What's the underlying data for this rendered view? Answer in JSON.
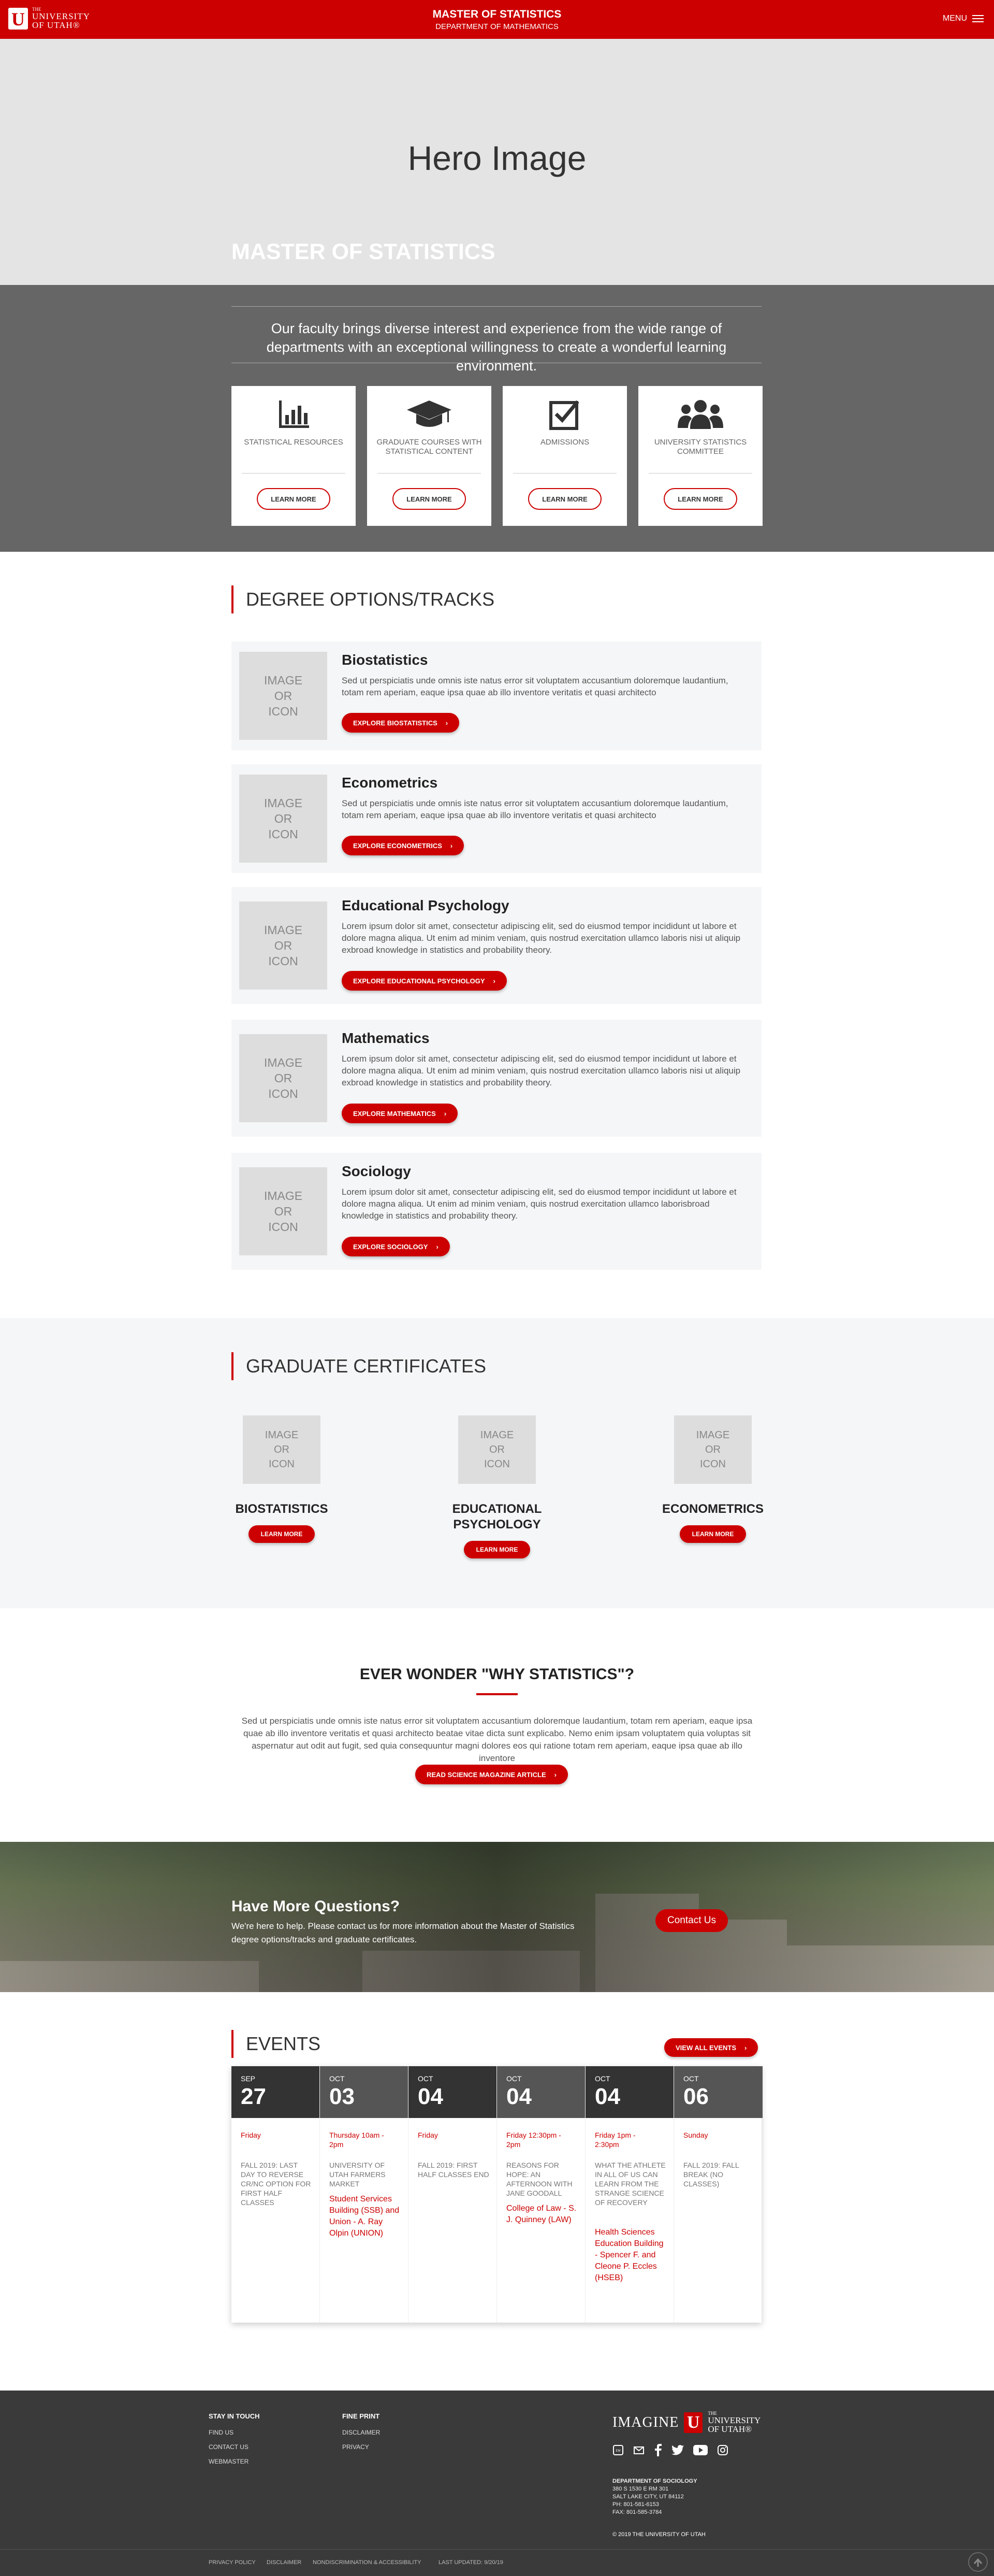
{
  "header": {
    "the": "THE",
    "university": "UNIVERSITY",
    "of_utah": "OF UTAH®",
    "title": "MASTER OF STATISTICS",
    "subtitle": "DEPARTMENT OF MATHEMATICS",
    "menu_label": "MENU"
  },
  "hero": {
    "placeholder": "Hero Image",
    "heading": "MASTER OF STATISTICS"
  },
  "intro": {
    "text": "Our faculty brings diverse interest and experience from the wide range of departments with an exceptional willingness to create a wonderful learning environment.",
    "cards": [
      {
        "label": "STATISTICAL RESOURCES",
        "icon": "bar-chart-icon",
        "button": "LEARN MORE"
      },
      {
        "label": "GRADUATE COURSES WITH STATISTICAL CONTENT",
        "icon": "graduation-cap-icon",
        "button": "LEARN MORE"
      },
      {
        "label": "ADMISSIONS",
        "icon": "checkbox-icon",
        "button": "LEARN MORE"
      },
      {
        "label": "UNIVERSITY STATISTICS COMMITTEE",
        "icon": "users-icon",
        "button": "LEARN MORE"
      }
    ]
  },
  "degrees": {
    "heading": "DEGREE OPTIONS/TRACKS",
    "image_placeholder": "IMAGE OR ICON",
    "items": [
      {
        "title": "Biostatistics",
        "text": "Sed ut perspiciatis unde omnis iste natus error sit voluptatem accusantium doloremque laudantium, totam rem aperiam, eaque ipsa quae ab illo inventore veritatis et quasi architecto",
        "button": "EXPLORE BIOSTATISTICS"
      },
      {
        "title": "Econometrics",
        "text": "Sed ut perspiciatis unde omnis iste natus error sit voluptatem accusantium doloremque laudantium, totam rem aperiam, eaque ipsa quae ab illo inventore veritatis et quasi architecto",
        "button": "EXPLORE ECONOMETRICS"
      },
      {
        "title": "Educational Psychology",
        "text": "Lorem ipsum dolor sit amet, consectetur adipiscing elit, sed do eiusmod tempor incididunt ut labore et dolore magna aliqua. Ut enim ad minim veniam, quis nostrud exercitation ullamco laboris nisi ut aliquip exbroad knowledge in statistics and probability theory.",
        "button": "EXPLORE EDUCATIONAL PSYCHOLOGY"
      },
      {
        "title": "Mathematics",
        "text": "Lorem ipsum dolor sit amet, consectetur adipiscing elit, sed do eiusmod tempor incididunt ut labore et dolore magna aliqua. Ut enim ad minim veniam, quis nostrud exercitation ullamco laboris nisi ut aliquip exbroad knowledge in statistics and probability theory.",
        "button": "EXPLORE MATHEMATICS"
      },
      {
        "title": "Sociology",
        "text": "Lorem ipsum dolor sit amet, consectetur adipiscing elit, sed do eiusmod tempor incididunt ut labore et dolore magna aliqua. Ut enim ad minim veniam, quis nostrud exercitation ullamco laborisbroad knowledge in statistics and probability theory.",
        "button": "EXPLORE SOCIOLOGY"
      }
    ]
  },
  "certificates": {
    "heading": "GRADUATE CERTIFICATES",
    "image_placeholder": "IMAGE OR ICON",
    "items": [
      {
        "title": "BIOSTATISTICS",
        "button": "LEARN MORE"
      },
      {
        "title": "EDUCATIONAL PSYCHOLOGY",
        "button": "LEARN MORE"
      },
      {
        "title": "ECONOMETRICS",
        "button": "LEARN MORE"
      }
    ]
  },
  "why": {
    "heading": "EVER WONDER \"WHY STATISTICS\"?",
    "text": "Sed ut perspiciatis unde omnis iste natus error sit voluptatem accusantium doloremque laudantium, totam rem aperiam, eaque ipsa quae ab illo inventore veritatis et quasi architecto beatae vitae dicta sunt explicabo. Nemo enim ipsam voluptatem quia voluptas sit aspernatur aut odit aut fugit, sed quia consequuntur magni dolores eos qui ratione totam rem aperiam, eaque ipsa quae ab illo inventore",
    "button": "READ SCIENCE MAGAZINE ARTICLE"
  },
  "cta": {
    "heading": "Have More Questions?",
    "text": "We're here to help. Please contact us for more information about the Master of Statistics degree options/tracks and graduate certificates.",
    "button": "Contact Us"
  },
  "events": {
    "heading": "EVENTS",
    "view_all": "VIEW ALL EVENTS",
    "items": [
      {
        "month": "SEP",
        "day": "27",
        "when": "Friday",
        "desc": "FALL 2019: LAST DAY TO REVERSE CR/NC OPTION FOR FIRST HALF CLASSES",
        "location": "",
        "color": "#333333"
      },
      {
        "month": "OCT",
        "day": "03",
        "when": "Thursday 10am - 2pm",
        "desc": "UNIVERSITY OF UTAH FARMERS MARKET",
        "location": "Student Services Building (SSB) and Union - A. Ray Olpin (UNION)",
        "color": "#555555"
      },
      {
        "month": "OCT",
        "day": "04",
        "when": "Friday",
        "desc": "FALL 2019: FIRST HALF CLASSES END",
        "location": "",
        "color": "#333333"
      },
      {
        "month": "OCT",
        "day": "04",
        "when": "Friday 12:30pm - 2pm",
        "desc": "REASONS FOR HOPE: AN AFTERNOON WITH JANE GOODALL",
        "location": "College of Law - S. J. Quinney (LAW)",
        "color": "#555555"
      },
      {
        "month": "OCT",
        "day": "04",
        "when": "Friday 1pm - 2:30pm",
        "desc": "WHAT THE ATHLETE IN ALL OF US CAN LEARN FROM THE STRANGE SCIENCE OF RECOVERY",
        "location": "Health Sciences Education Building - Spencer F. and Cleone P. Eccles (HSEB)",
        "color": "#333333"
      },
      {
        "month": "OCT",
        "day": "06",
        "when": "Sunday",
        "desc": "FALL 2019: FALL BREAK (NO CLASSES)",
        "location": "",
        "color": "#555555"
      }
    ]
  },
  "footer": {
    "stay_in_touch": "STAY IN TOUCH",
    "links1": [
      "FIND US",
      "CONTACT US",
      "WEBMASTER"
    ],
    "fine_print": "FINE PRINT",
    "links2": [
      "DISCLAIMER",
      "PRIVACY"
    ],
    "imagine": "IMAGINE",
    "the": "THE",
    "university": "UNIVERSITY",
    "of_utah": "OF UTAH®",
    "address": [
      "DEPARTMENT OF SOCIOLOGY",
      "380 S 1530 E RM 301",
      "SALT LAKE CITY, UT 84112",
      "PH: 801-581-6153",
      "FAX: 801-585-3784"
    ],
    "copyright": "© 2019 THE UNIVERSITY OF UTAH",
    "bottom": [
      "PRIVACY POLICY",
      "DISCLAIMER",
      "NONDISCRIMINATION & ACCESSIBILITY",
      "LAST UPDATED: 9/20/19"
    ]
  },
  "colors": {
    "brand_red": "#cc0000",
    "dark": "#3a3a3a",
    "gray": "#666666"
  }
}
